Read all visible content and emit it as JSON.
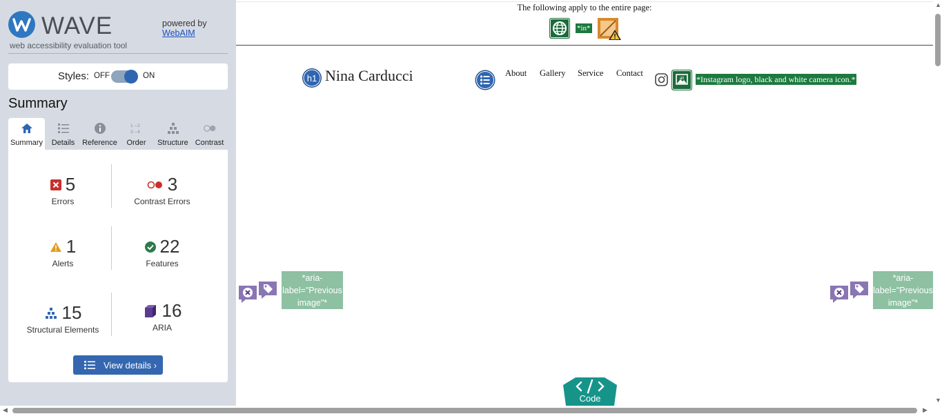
{
  "wave": {
    "logo_text": "WAVE",
    "subtitle": "web accessibility evaluation tool",
    "powered_by": "powered by",
    "webaim_link": "WebAIM"
  },
  "styles": {
    "label": "Styles:",
    "off": "OFF",
    "on": "ON",
    "enabled": true
  },
  "summary_title": "Summary",
  "tabs": [
    {
      "label": "Summary",
      "icon": "home-icon",
      "active": true
    },
    {
      "label": "Details",
      "icon": "list-icon",
      "active": false
    },
    {
      "label": "Reference",
      "icon": "info-icon",
      "active": false
    },
    {
      "label": "Order",
      "icon": "order-icon",
      "active": false
    },
    {
      "label": "Structure",
      "icon": "structure-icon",
      "active": false
    },
    {
      "label": "Contrast",
      "icon": "contrast-icon",
      "active": false
    }
  ],
  "stats": {
    "errors": {
      "count": "5",
      "label": "Errors"
    },
    "contrast_errors": {
      "count": "3",
      "label": "Contrast Errors"
    },
    "alerts": {
      "count": "1",
      "label": "Alerts"
    },
    "features": {
      "count": "22",
      "label": "Features"
    },
    "structural": {
      "count": "15",
      "label": "Structural Elements"
    },
    "aria": {
      "count": "16",
      "label": "ARIA"
    }
  },
  "view_details": "View details ›",
  "page": {
    "banner_text": "The following apply to the entire page:",
    "lang_badge": "*in*",
    "site_title": "Nina Carducci",
    "h1_badge": "h1",
    "nav": [
      "About",
      "Gallery",
      "Service",
      "Contact"
    ],
    "instagram_alt": "*Instagram logo, black and white camera icon.*",
    "aria_label_left": "*aria-label=\"Previous image\"*",
    "aria_label_right": "*aria-label=\"Previous image\"*",
    "code_label": "Code"
  },
  "colors": {
    "sidebar_bg": "#d6dbe3",
    "accent_blue": "#3467b0",
    "error_red": "#c9302c",
    "feature_green": "#1c7a3f",
    "aria_purple": "#5b3a91",
    "code_teal": "#16948a"
  }
}
